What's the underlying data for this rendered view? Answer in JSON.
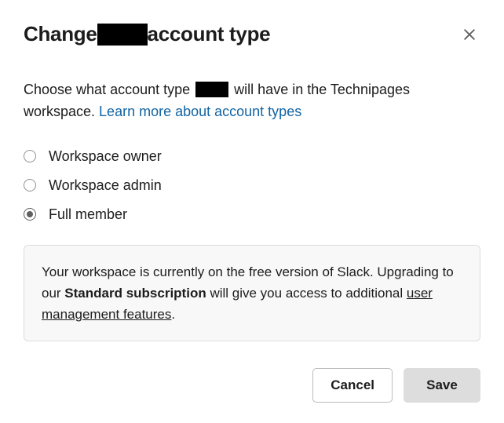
{
  "dialog": {
    "title_prefix": "Change",
    "title_suffix": "account type",
    "description_prefix": "Choose what account type",
    "description_suffix_1": "will have in the ",
    "workspace_name": "Technipages",
    "description_suffix_2": " workspace. ",
    "learn_more_text": "Learn more about account types"
  },
  "options": {
    "owner": "Workspace owner",
    "admin": "Workspace admin",
    "member": "Full member"
  },
  "info": {
    "line1": "Your workspace is currently on the free version of Slack. Upgrading to our ",
    "bold": "Standard subscription",
    "line2": " will give you access to additional ",
    "link": "user management features",
    "period": "."
  },
  "buttons": {
    "cancel": "Cancel",
    "save": "Save"
  }
}
